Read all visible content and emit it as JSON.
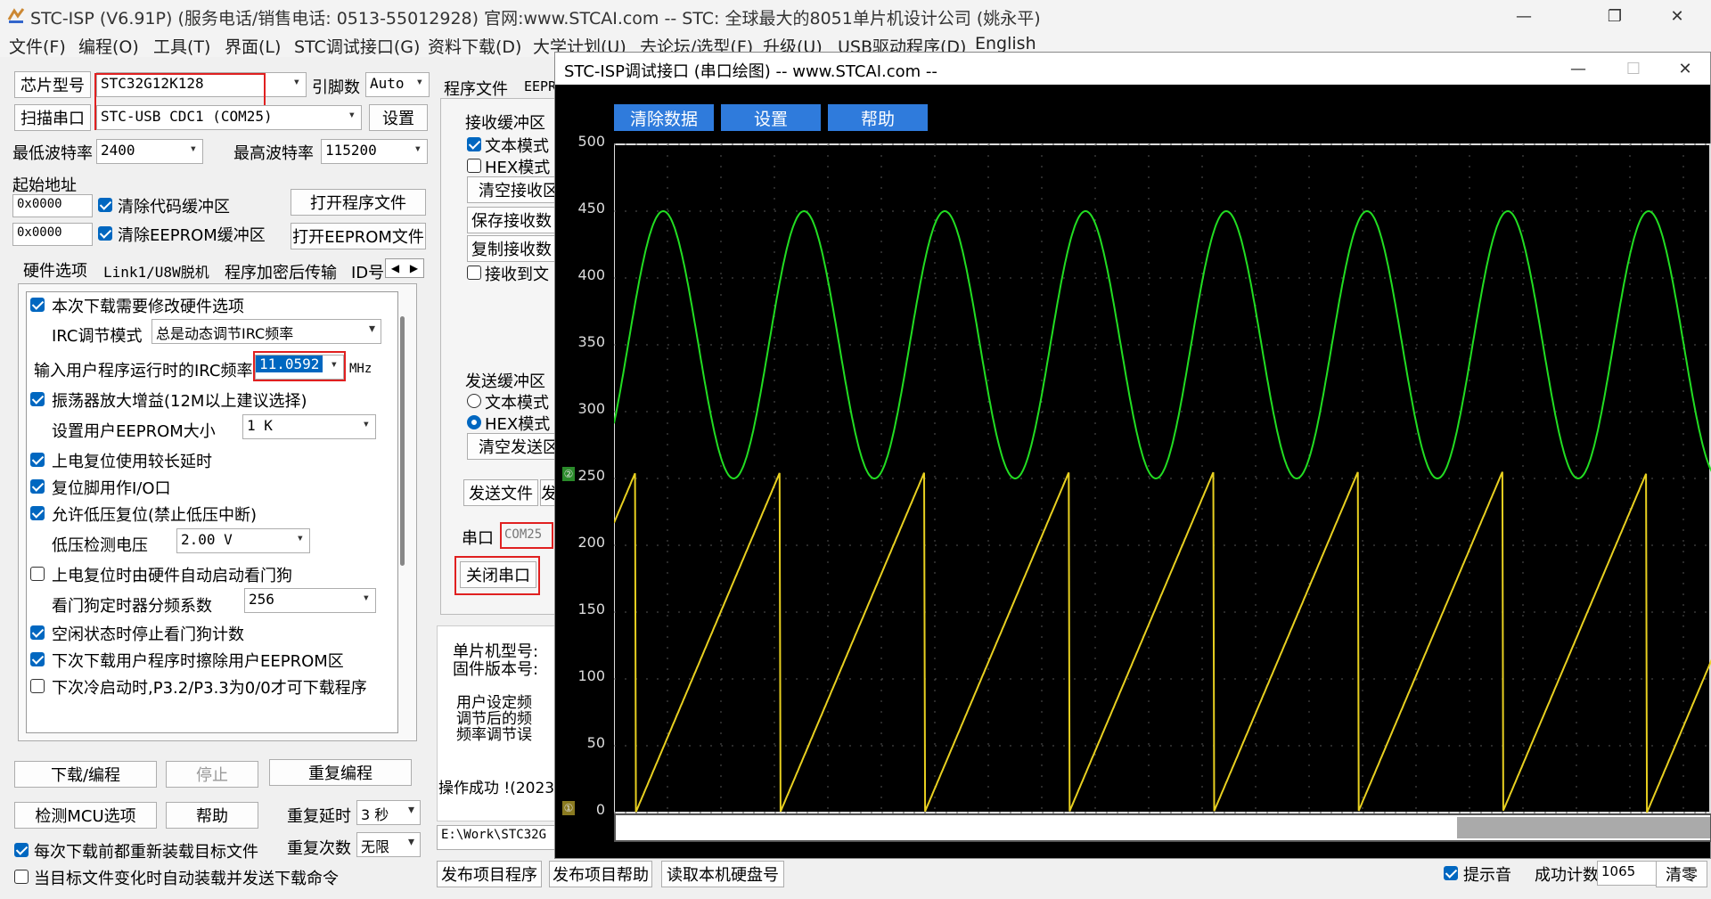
{
  "main_window": {
    "title": "STC-ISP (V6.91P) (服务电话/销售电话: 0513-55012928) 官网:www.STCAI.com  -- STC: 全球最大的8051单片机设计公司 (姚永平)"
  },
  "menu": [
    "文件(F)",
    "编程(O)",
    "工具(T)",
    "界面(L)",
    "STC调试接口(G)",
    "资料下载(D)",
    "大学计划(U)",
    "去论坛/选型(F)",
    "升级(U)",
    "USB驱动程序(D)",
    "English"
  ],
  "left": {
    "chip_model_label": "芯片型号",
    "chip_model_value": "STC32G12K128",
    "pin_label": "引脚数",
    "pin_value": "Auto",
    "scan_port_button": "扫描串口",
    "port_value": "STC-USB CDC1 (COM25)",
    "settings_button": "设置",
    "min_baud_label": "最低波特率",
    "min_baud_value": "2400",
    "max_baud_label": "最高波特率",
    "max_baud_value": "115200",
    "start_addr_label": "起始地址",
    "addr1": "0x0000",
    "clear_code_buffer": "清除代码缓冲区",
    "open_program_file": "打开程序文件",
    "addr2": "0x0000",
    "clear_eeprom_buffer": "清除EEPROM缓冲区",
    "open_eeprom_file": "打开EEPROM文件",
    "tabs": [
      "硬件选项",
      "Link1/U8W脱机",
      "程序加密后传输",
      "ID号"
    ],
    "hw": {
      "modify_hw": "本次下载需要修改硬件选项",
      "irc_mode_label": "IRC调节模式",
      "irc_mode_value": "总是动态调节IRC频率",
      "irc_freq_label": "输入用户程序运行时的IRC频率",
      "irc_freq_value": "11.0592",
      "irc_freq_unit": "MHz",
      "osc_gain": "振荡器放大增益(12M以上建议选择)",
      "eeprom_size_label": "设置用户EEPROM大小",
      "eeprom_size_value": "1   K",
      "long_reset_delay": "上电复位使用较长延时",
      "reset_pin_io": "复位脚用作I/O口",
      "low_volt_reset": "允许低压复位(禁止低压中断)",
      "low_volt_label": "低压检测电压",
      "low_volt_value": "2.00 V",
      "watchdog_auto": "上电复位时由硬件自动启动看门狗",
      "watchdog_div_label": "看门狗定时器分频系数",
      "watchdog_div_value": "256",
      "idle_stop_wdt": "空闲状态时停止看门狗计数",
      "erase_eeprom": "下次下载用户程序时擦除用户EEPROM区",
      "cold_boot": "下次冷启动时,P3.2/P3.3为0/0才可下载程序"
    },
    "download_button": "下载/编程",
    "stop_button": "停止",
    "reprogram_button": "重复编程",
    "check_mcu_button": "检测MCU选项",
    "help_button": "帮助",
    "repeat_delay_label": "重复延时",
    "repeat_delay_value": "3 秒",
    "repeat_count_label": "重复次数",
    "repeat_count_value": "无限",
    "reload_each": "每次下载前都重新装载目标文件",
    "auto_reload": "当目标文件变化时自动装载并发送下载命令"
  },
  "middle": {
    "tab_program_file": "程序文件",
    "tab_eeprom": "EEPR",
    "recv_buffer": "接收缓冲区",
    "text_mode": "文本模式",
    "hex_mode": "HEX模式",
    "clear_recv": "清空接收区",
    "save_recv": "保存接收数",
    "copy_recv": "复制接收数",
    "recv_to_file": "接收到文",
    "send_buffer": "发送缓冲区",
    "send_text_mode": "文本模式",
    "send_hex_mode": "HEX模式",
    "clear_send": "清空发送区",
    "send_file": "发送文件",
    "send_file_extra": "发",
    "port_label": "串口",
    "port_value": "COM25",
    "close_port": "关闭串口",
    "mcu_model_label": "单片机型号:",
    "firmware_label": "固件版本号:",
    "info1": "用户设定频",
    "info2": "调节后的频",
    "info3": "频率调节误",
    "status": "操作成功 !(2023",
    "path": "E:\\Work\\STC32G"
  },
  "bottom": {
    "publish_program": "发布项目程序",
    "publish_help": "发布项目帮助",
    "read_disk": "读取本机硬盘号",
    "beep": "提示音",
    "success_count_label": "成功计数",
    "success_count": "1065",
    "clear_count": "清零"
  },
  "plot_window": {
    "title": "STC-ISP调试接口 (串口绘图) -- www.STCAI.com --",
    "buttons": [
      "清除数据",
      "设置",
      "帮助"
    ],
    "y_ticks": [
      "500",
      "450",
      "400",
      "350",
      "300",
      "250",
      "200",
      "150",
      "100",
      "50",
      "0"
    ],
    "channel_marker_1": "①",
    "channel_marker_2": "②"
  },
  "chart_data": {
    "type": "line",
    "ylim": [
      0,
      500
    ],
    "series": [
      {
        "color": "#22dd22",
        "shape": "sine",
        "min": 250,
        "max": 450,
        "cycles": 7.8
      },
      {
        "color": "#e8d020",
        "shape": "sawtooth",
        "min": 0,
        "max": 255,
        "cycles": 7.6
      }
    ]
  }
}
